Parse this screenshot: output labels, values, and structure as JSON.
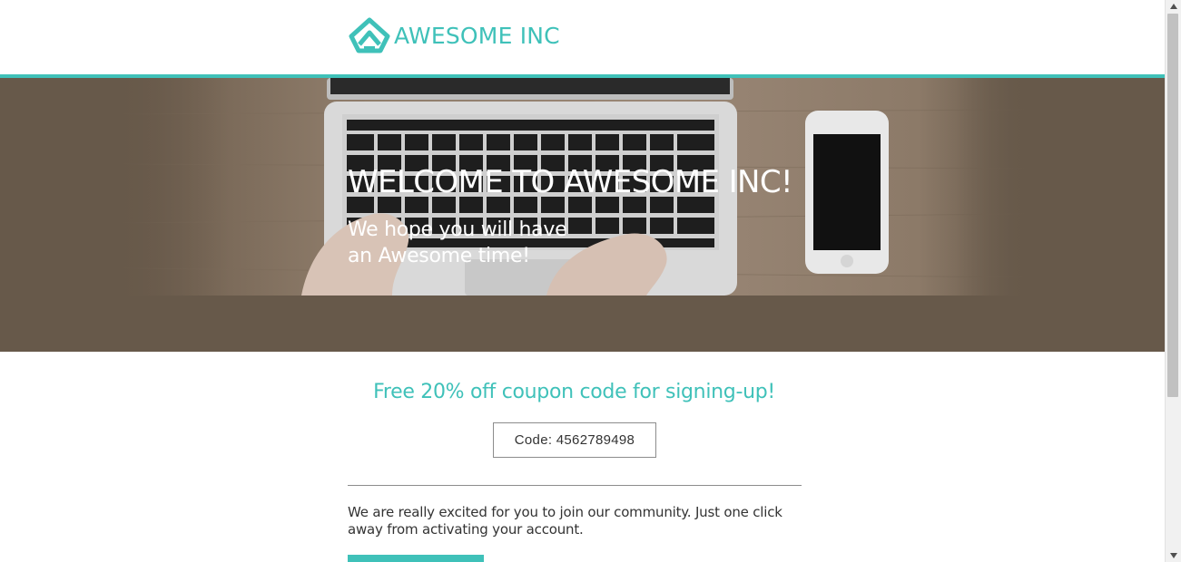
{
  "brand": {
    "name": "AWESOME INC",
    "color": "#3fc1b9"
  },
  "hero": {
    "title": "WELCOME TO AWESOME INC!",
    "subtitle": "We hope you will have an Awesome time!",
    "background": "#67594a"
  },
  "coupon": {
    "heading": "Free 20% off coupon code for signing-up!",
    "code_label": "Code: 4562789498"
  },
  "body": {
    "message": "We are really excited for you to join our community. Just one click away from activating your account."
  },
  "icons": {
    "logo": "awesome-inc-logo-icon",
    "scroll_up": "triangle-up-icon",
    "scroll_down": "triangle-down-icon"
  }
}
